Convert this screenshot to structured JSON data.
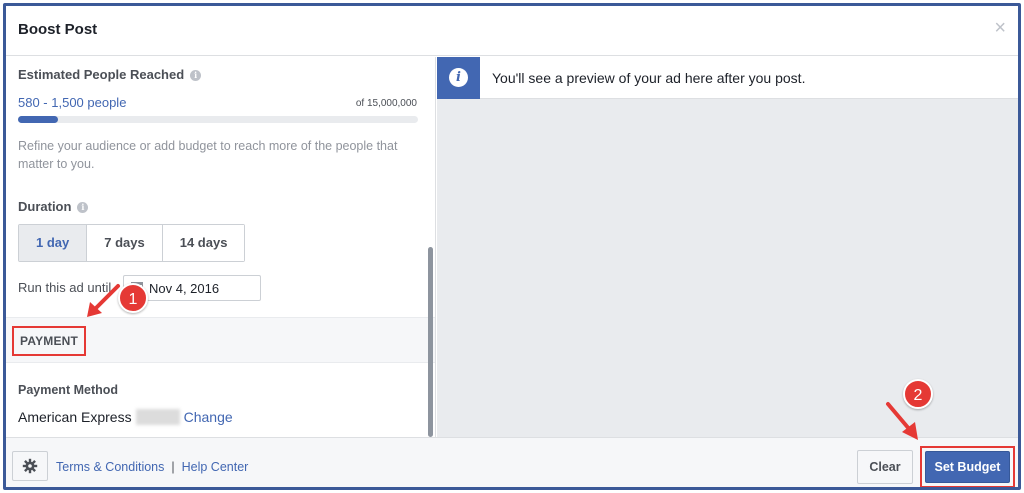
{
  "dialog": {
    "title": "Boost Post",
    "close_glyph": "×"
  },
  "audience": {
    "label": "Estimated People Reached",
    "reach": "580 - 1,500 people",
    "total": "of 15,000,000",
    "progress_fraction": 0.1,
    "hint": "Refine your audience or add budget to reach more of the people that matter to you."
  },
  "duration": {
    "label": "Duration",
    "options": [
      "1 day",
      "7 days",
      "14 days"
    ],
    "selected": "1 day",
    "run_until_label": "Run this ad until",
    "end_date": "Nov 4, 2016"
  },
  "payment": {
    "section_title": "PAYMENT",
    "method_label": "Payment Method",
    "method_value": "American Express",
    "change_link": "Change"
  },
  "preview": {
    "message": "You'll see a preview of your ad here after you post."
  },
  "footer": {
    "terms": "Terms & Conditions",
    "separator": "|",
    "help": "Help Center",
    "clear": "Clear",
    "set_budget": "Set Budget"
  },
  "annotations": {
    "step1": "1",
    "step2": "2"
  },
  "colors": {
    "accent": "#4267b2",
    "highlight": "#e53935",
    "frame": "#3b5998"
  }
}
